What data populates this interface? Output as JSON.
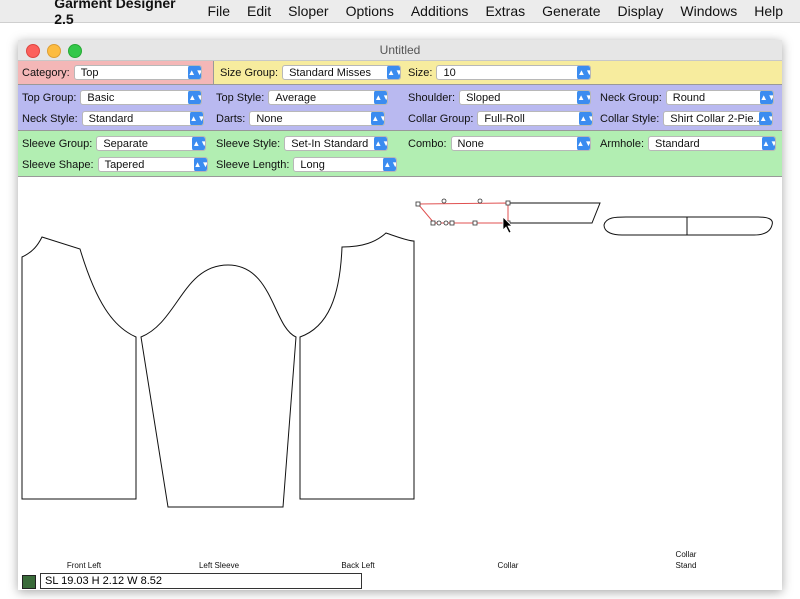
{
  "menubar": {
    "apple_glyph": "",
    "app_name": "Garment Designer 2.5",
    "items": [
      "File",
      "Edit",
      "Sloper",
      "Options",
      "Additions",
      "Extras",
      "Generate",
      "Display",
      "Windows",
      "Help"
    ]
  },
  "window": {
    "title": "Untitled"
  },
  "controls": {
    "category": {
      "label": "Category:",
      "value": "Top"
    },
    "size_group": {
      "label": "Size Group:",
      "value": "Standard Misses"
    },
    "size": {
      "label": "Size:",
      "value": "10"
    },
    "top_group": {
      "label": "Top Group:",
      "value": "Basic"
    },
    "top_style": {
      "label": "Top Style:",
      "value": "Average"
    },
    "shoulder": {
      "label": "Shoulder:",
      "value": "Sloped"
    },
    "neck_group": {
      "label": "Neck Group:",
      "value": "Round"
    },
    "neck_style": {
      "label": "Neck Style:",
      "value": "Standard"
    },
    "darts": {
      "label": "Darts:",
      "value": "None"
    },
    "collar_group": {
      "label": "Collar Group:",
      "value": "Full-Roll"
    },
    "collar_style": {
      "label": "Collar Style:",
      "value": "Shirt Collar 2-Pie..."
    },
    "sleeve_group": {
      "label": "Sleeve Group:",
      "value": "Separate"
    },
    "sleeve_style": {
      "label": "Sleeve Style:",
      "value": "Set-In Standard"
    },
    "combo": {
      "label": "Combo:",
      "value": "None"
    },
    "armhole": {
      "label": "Armhole:",
      "value": "Standard"
    },
    "sleeve_shape": {
      "label": "Sleeve Shape:",
      "value": "Tapered"
    },
    "sleeve_length": {
      "label": "Sleeve Length:",
      "value": "Long"
    }
  },
  "pieces": {
    "front_left": "Front Left",
    "left_sleeve": "Left Sleeve",
    "back_left": "Back Left",
    "collar": "Collar",
    "collar_stand_line1": "Collar",
    "collar_stand_line2": "Stand"
  },
  "status": {
    "text": "SL 19.03  H 2.12  W 8.52"
  },
  "colors": {
    "band_category": "#f4b7b7",
    "band_size": "#f7ec9e",
    "band_top": "#b9b9f0",
    "band_sleeve": "#b2eeb2",
    "selection": "#e05050",
    "select_arrow": "#3b8cf0"
  },
  "icons": {
    "close": "close-light-icon",
    "minimize": "minimize-light-icon",
    "zoom": "zoom-light-icon",
    "select_arrow": "chevron-updown-icon",
    "cursor": "arrow-cursor-icon"
  }
}
